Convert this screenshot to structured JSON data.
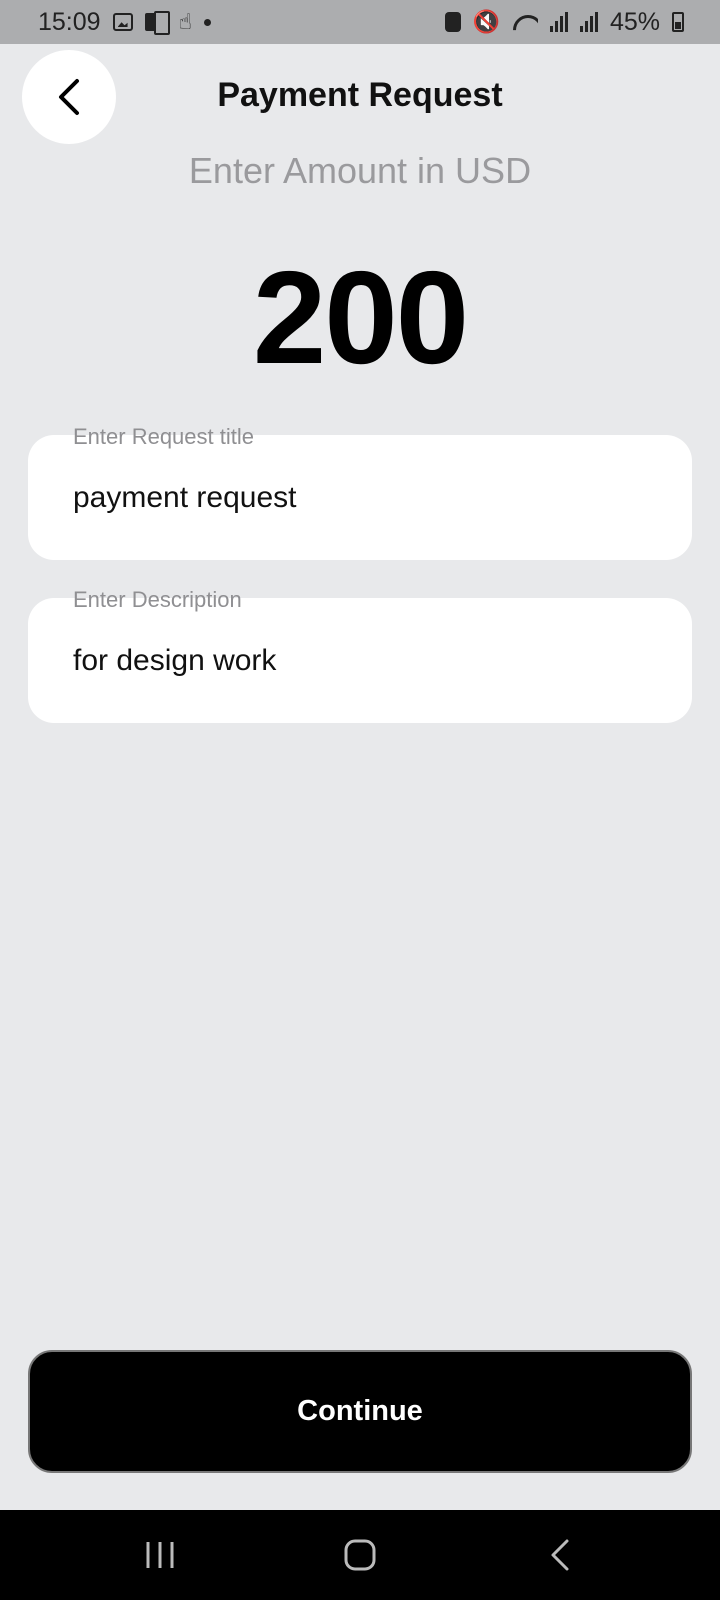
{
  "status_bar": {
    "time": "15:09",
    "battery": "45%",
    "icons": [
      "image-icon",
      "device-icon",
      "touch-icon",
      "dot-icon",
      "lock-icon",
      "mute-icon",
      "wifi-icon",
      "signal-icon",
      "signal-icon",
      "battery-icon"
    ]
  },
  "header": {
    "back_icon": "chevron-left-icon",
    "title": "Payment Request"
  },
  "amount": {
    "label": "Enter Amount in USD",
    "value": "200"
  },
  "fields": {
    "title": {
      "label": "Enter Request title",
      "value": "payment request"
    },
    "description": {
      "label": "Enter Description",
      "value": "for design work"
    }
  },
  "actions": {
    "continue_label": "Continue"
  },
  "nav_bar": {
    "recents_icon": "recents-icon",
    "home_icon": "home-icon",
    "back_icon": "back-icon"
  },
  "colors": {
    "background": "#e8e9eb",
    "status_bar": "#acadaf",
    "field": "#ffffff",
    "button": "#000000",
    "muted_text": "#9a9a9d"
  }
}
